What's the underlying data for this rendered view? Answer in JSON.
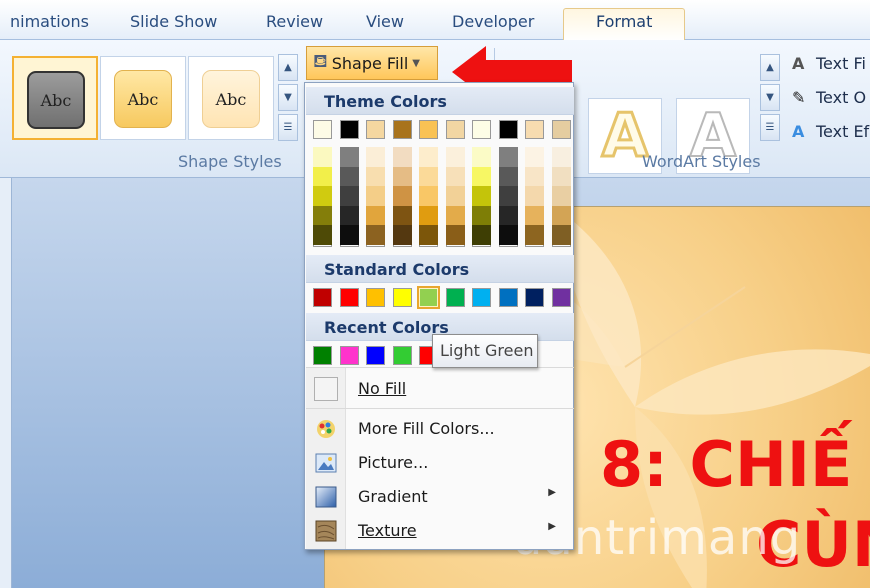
{
  "tabs": [
    {
      "label": "nimations"
    },
    {
      "label": "Slide Show"
    },
    {
      "label": "Review"
    },
    {
      "label": "View"
    },
    {
      "label": "Developer"
    },
    {
      "label": "Format",
      "active": true
    }
  ],
  "ribbon": {
    "shape_styles": {
      "thumbnails": [
        "Abc",
        "Abc",
        "Abc"
      ],
      "group_label": "Shape Styles"
    },
    "shape_fill_label": "Shape Fill",
    "wordart_styles": {
      "thumbnails": [
        "A",
        "A"
      ],
      "group_label": "WordArt Styles"
    },
    "text_commands": [
      "Text Fi",
      "Text O",
      "Text Ef"
    ]
  },
  "dropdown": {
    "theme_colors_header": "Theme Colors",
    "theme_colors_top": [
      "#fdfbe6",
      "#000000",
      "#f5d7a0",
      "#a8731c",
      "#f9c254",
      "#f2d6a3",
      "#fdfde6",
      "#000000",
      "#f7dcb0",
      "#e5cda0"
    ],
    "theme_colors_shades": [
      [
        "#fbf9c0",
        "#f2ef4a",
        "#d0cb10",
        "#847e0a",
        "#4e4a06"
      ],
      [
        "#7f7f7f",
        "#595959",
        "#3f3f3f",
        "#262626",
        "#0d0d0d"
      ],
      [
        "#fbeed7",
        "#f8deaf",
        "#f4ce88",
        "#e1a53c",
        "#8c6220"
      ],
      [
        "#f2dcc1",
        "#e5bc85",
        "#cf9344",
        "#7e5412",
        "#543810"
      ],
      [
        "#fdedcc",
        "#fbda99",
        "#f9c766",
        "#e09c10",
        "#7c560a"
      ],
      [
        "#fbf0dc",
        "#f7e0b9",
        "#f2d197",
        "#e3ab4a",
        "#8a5e18"
      ],
      [
        "#fbfbc6",
        "#f7f764",
        "#c4c40a",
        "#7e7e06",
        "#3e3e04"
      ],
      [
        "#7f7f7f",
        "#595959",
        "#3f3f3f",
        "#262626",
        "#0d0d0d"
      ],
      [
        "#fcf3e4",
        "#f8e5c7",
        "#f4d8ac",
        "#e6b25c",
        "#8d6520"
      ],
      [
        "#f8efe0",
        "#f1dfc1",
        "#e9cfa3",
        "#d3a455",
        "#7f5f24"
      ]
    ],
    "standard_colors_header": "Standard Colors",
    "standard_colors": [
      "#c00000",
      "#ff0000",
      "#ffc000",
      "#ffff00",
      "#92d050",
      "#00b050",
      "#00b0f0",
      "#0070c0",
      "#002060",
      "#7030a0"
    ],
    "standard_selected_index": 4,
    "recent_colors_header": "Recent Colors",
    "recent_colors": [
      "#008000",
      "#ff33cc",
      "#0000ff",
      "#33cc33",
      "#ff0000"
    ],
    "no_fill_label": "No Fill",
    "more_fill_colors_label": "More Fill Colors...",
    "picture_label": "Picture...",
    "gradient_label": "Gradient",
    "texture_label": "Texture"
  },
  "tooltip": "Light Green",
  "slide": {
    "title_line1": "8: CHIẾ",
    "title_line2": "CÙN"
  },
  "watermark": "uantrimang"
}
